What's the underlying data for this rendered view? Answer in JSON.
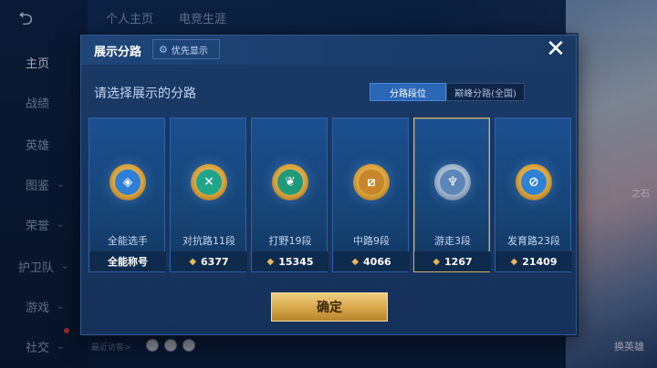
{
  "background": {
    "nav": {
      "back_icon": "back-arrow-icon",
      "items": [
        {
          "label": "主页",
          "active": true
        },
        {
          "label": "战绩"
        },
        {
          "label": "英雄"
        },
        {
          "label": "图鉴",
          "has_chevron": true
        },
        {
          "label": "荣誉",
          "has_chevron": true
        },
        {
          "label": "护卫队",
          "has_chevron": true
        },
        {
          "label": "游戏",
          "has_chevron": true
        },
        {
          "label": "社交",
          "has_chevron": true
        }
      ]
    },
    "top_tabs": [
      {
        "label": "个人主页"
      },
      {
        "label": "电竞生涯"
      }
    ],
    "recent_visitors": "最近访客>",
    "right_labels": [
      "之石",
      "换英雄"
    ]
  },
  "modal": {
    "title": "展示分路",
    "priority_button": {
      "label": "优先显示",
      "icon": "gear-icon"
    },
    "close_icon": "close-icon",
    "prompt": "请选择展示的分路",
    "segments": [
      {
        "label": "分路段位",
        "active": true
      },
      {
        "label": "巅峰分路(全国)",
        "active": false
      }
    ],
    "cards": [
      {
        "name": "全能选手",
        "score": "全能称号",
        "has_diamond": false,
        "selected": false,
        "emblem_icon": "all-round-emblem-icon",
        "emblem_color": "#2d7fd8"
      },
      {
        "name": "对抗路11段",
        "score": "6377",
        "has_diamond": true,
        "selected": false,
        "emblem_icon": "clash-lane-emblem-icon",
        "emblem_color": "#1fa58a"
      },
      {
        "name": "打野19段",
        "score": "15345",
        "has_diamond": true,
        "selected": false,
        "emblem_icon": "jungle-emblem-icon",
        "emblem_color": "#1f9a78"
      },
      {
        "name": "中路9段",
        "score": "4066",
        "has_diamond": true,
        "selected": false,
        "emblem_icon": "mid-lane-emblem-icon",
        "emblem_color": "#c8862a"
      },
      {
        "name": "游走3段",
        "score": "1267",
        "has_diamond": true,
        "selected": true,
        "emblem_icon": "roam-emblem-icon",
        "emblem_color": "#5d86b8"
      },
      {
        "name": "发育路23段",
        "score": "21409",
        "has_diamond": true,
        "selected": false,
        "emblem_icon": "farm-lane-emblem-icon",
        "emblem_color": "#2d82d4"
      }
    ],
    "confirm_label": "确定"
  }
}
